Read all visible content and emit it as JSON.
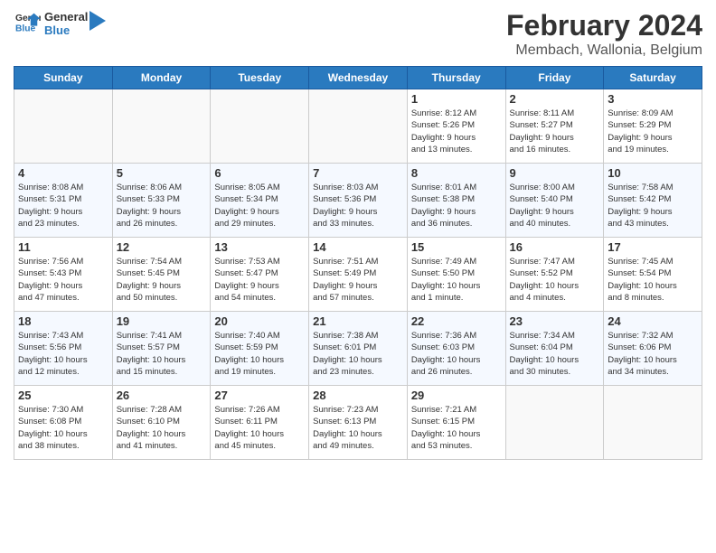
{
  "logo": {
    "text_general": "General",
    "text_blue": "Blue"
  },
  "header": {
    "month_year": "February 2024",
    "location": "Membach, Wallonia, Belgium"
  },
  "weekdays": [
    "Sunday",
    "Monday",
    "Tuesday",
    "Wednesday",
    "Thursday",
    "Friday",
    "Saturday"
  ],
  "weeks": [
    [
      {
        "day": "",
        "info": ""
      },
      {
        "day": "",
        "info": ""
      },
      {
        "day": "",
        "info": ""
      },
      {
        "day": "",
        "info": ""
      },
      {
        "day": "1",
        "info": "Sunrise: 8:12 AM\nSunset: 5:26 PM\nDaylight: 9 hours\nand 13 minutes."
      },
      {
        "day": "2",
        "info": "Sunrise: 8:11 AM\nSunset: 5:27 PM\nDaylight: 9 hours\nand 16 minutes."
      },
      {
        "day": "3",
        "info": "Sunrise: 8:09 AM\nSunset: 5:29 PM\nDaylight: 9 hours\nand 19 minutes."
      }
    ],
    [
      {
        "day": "4",
        "info": "Sunrise: 8:08 AM\nSunset: 5:31 PM\nDaylight: 9 hours\nand 23 minutes."
      },
      {
        "day": "5",
        "info": "Sunrise: 8:06 AM\nSunset: 5:33 PM\nDaylight: 9 hours\nand 26 minutes."
      },
      {
        "day": "6",
        "info": "Sunrise: 8:05 AM\nSunset: 5:34 PM\nDaylight: 9 hours\nand 29 minutes."
      },
      {
        "day": "7",
        "info": "Sunrise: 8:03 AM\nSunset: 5:36 PM\nDaylight: 9 hours\nand 33 minutes."
      },
      {
        "day": "8",
        "info": "Sunrise: 8:01 AM\nSunset: 5:38 PM\nDaylight: 9 hours\nand 36 minutes."
      },
      {
        "day": "9",
        "info": "Sunrise: 8:00 AM\nSunset: 5:40 PM\nDaylight: 9 hours\nand 40 minutes."
      },
      {
        "day": "10",
        "info": "Sunrise: 7:58 AM\nSunset: 5:42 PM\nDaylight: 9 hours\nand 43 minutes."
      }
    ],
    [
      {
        "day": "11",
        "info": "Sunrise: 7:56 AM\nSunset: 5:43 PM\nDaylight: 9 hours\nand 47 minutes."
      },
      {
        "day": "12",
        "info": "Sunrise: 7:54 AM\nSunset: 5:45 PM\nDaylight: 9 hours\nand 50 minutes."
      },
      {
        "day": "13",
        "info": "Sunrise: 7:53 AM\nSunset: 5:47 PM\nDaylight: 9 hours\nand 54 minutes."
      },
      {
        "day": "14",
        "info": "Sunrise: 7:51 AM\nSunset: 5:49 PM\nDaylight: 9 hours\nand 57 minutes."
      },
      {
        "day": "15",
        "info": "Sunrise: 7:49 AM\nSunset: 5:50 PM\nDaylight: 10 hours\nand 1 minute."
      },
      {
        "day": "16",
        "info": "Sunrise: 7:47 AM\nSunset: 5:52 PM\nDaylight: 10 hours\nand 4 minutes."
      },
      {
        "day": "17",
        "info": "Sunrise: 7:45 AM\nSunset: 5:54 PM\nDaylight: 10 hours\nand 8 minutes."
      }
    ],
    [
      {
        "day": "18",
        "info": "Sunrise: 7:43 AM\nSunset: 5:56 PM\nDaylight: 10 hours\nand 12 minutes."
      },
      {
        "day": "19",
        "info": "Sunrise: 7:41 AM\nSunset: 5:57 PM\nDaylight: 10 hours\nand 15 minutes."
      },
      {
        "day": "20",
        "info": "Sunrise: 7:40 AM\nSunset: 5:59 PM\nDaylight: 10 hours\nand 19 minutes."
      },
      {
        "day": "21",
        "info": "Sunrise: 7:38 AM\nSunset: 6:01 PM\nDaylight: 10 hours\nand 23 minutes."
      },
      {
        "day": "22",
        "info": "Sunrise: 7:36 AM\nSunset: 6:03 PM\nDaylight: 10 hours\nand 26 minutes."
      },
      {
        "day": "23",
        "info": "Sunrise: 7:34 AM\nSunset: 6:04 PM\nDaylight: 10 hours\nand 30 minutes."
      },
      {
        "day": "24",
        "info": "Sunrise: 7:32 AM\nSunset: 6:06 PM\nDaylight: 10 hours\nand 34 minutes."
      }
    ],
    [
      {
        "day": "25",
        "info": "Sunrise: 7:30 AM\nSunset: 6:08 PM\nDaylight: 10 hours\nand 38 minutes."
      },
      {
        "day": "26",
        "info": "Sunrise: 7:28 AM\nSunset: 6:10 PM\nDaylight: 10 hours\nand 41 minutes."
      },
      {
        "day": "27",
        "info": "Sunrise: 7:26 AM\nSunset: 6:11 PM\nDaylight: 10 hours\nand 45 minutes."
      },
      {
        "day": "28",
        "info": "Sunrise: 7:23 AM\nSunset: 6:13 PM\nDaylight: 10 hours\nand 49 minutes."
      },
      {
        "day": "29",
        "info": "Sunrise: 7:21 AM\nSunset: 6:15 PM\nDaylight: 10 hours\nand 53 minutes."
      },
      {
        "day": "",
        "info": ""
      },
      {
        "day": "",
        "info": ""
      }
    ]
  ]
}
